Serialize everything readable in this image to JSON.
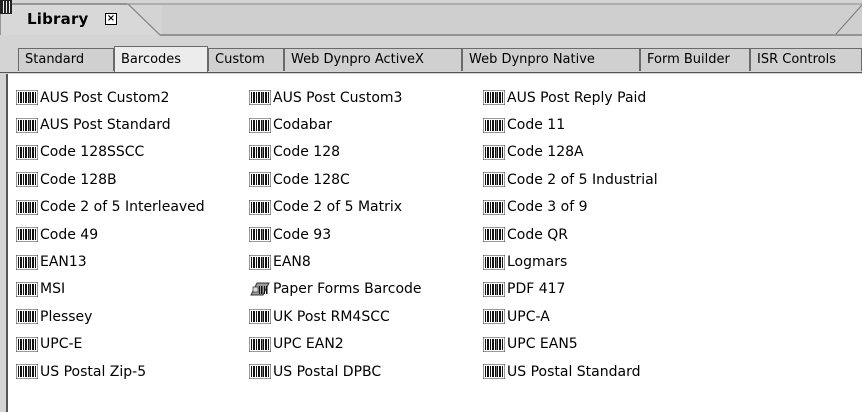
{
  "panel": {
    "title": "Library",
    "close_symbol": "×"
  },
  "tabs": [
    {
      "label": "Standard",
      "active": false
    },
    {
      "label": "Barcodes",
      "active": true
    },
    {
      "label": "Custom",
      "active": false
    },
    {
      "label": "Web Dynpro ActiveX",
      "active": false
    },
    {
      "label": "Web Dynpro Native",
      "active": false
    },
    {
      "label": "Form Builder",
      "active": false
    },
    {
      "label": "ISR Controls",
      "active": false
    }
  ],
  "columns": [
    [
      {
        "label": "AUS Post Custom2",
        "icon": "barcode-icon"
      },
      {
        "label": "AUS Post Standard",
        "icon": "barcode-icon"
      },
      {
        "label": "Code 128SSCC",
        "icon": "barcode-icon"
      },
      {
        "label": "Code 128B",
        "icon": "barcode-icon"
      },
      {
        "label": "Code 2 of 5 Interleaved",
        "icon": "barcode-icon"
      },
      {
        "label": "Code 49",
        "icon": "barcode-icon"
      },
      {
        "label": "EAN13",
        "icon": "barcode-icon"
      },
      {
        "label": "MSI",
        "icon": "barcode-icon"
      },
      {
        "label": "Plessey",
        "icon": "barcode-icon"
      },
      {
        "label": "UPC-E",
        "icon": "barcode-icon"
      },
      {
        "label": "US Postal Zip-5",
        "icon": "barcode-icon"
      }
    ],
    [
      {
        "label": "AUS Post Custom3",
        "icon": "barcode-icon"
      },
      {
        "label": "Codabar",
        "icon": "barcode-icon"
      },
      {
        "label": "Code 128",
        "icon": "barcode-icon"
      },
      {
        "label": "Code 128C",
        "icon": "barcode-icon"
      },
      {
        "label": "Code 2 of 5 Matrix",
        "icon": "barcode-icon"
      },
      {
        "label": "Code 93",
        "icon": "barcode-icon"
      },
      {
        "label": "EAN8",
        "icon": "barcode-icon"
      },
      {
        "label": "Paper Forms Barcode",
        "icon": "paper-forms-barcode-icon"
      },
      {
        "label": "UK Post RM4SCC",
        "icon": "barcode-icon"
      },
      {
        "label": "UPC EAN2",
        "icon": "barcode-icon"
      },
      {
        "label": "US Postal DPBC",
        "icon": "barcode-icon"
      }
    ],
    [
      {
        "label": "AUS Post Reply Paid",
        "icon": "barcode-icon"
      },
      {
        "label": "Code 11",
        "icon": "barcode-icon"
      },
      {
        "label": "Code 128A",
        "icon": "barcode-icon"
      },
      {
        "label": "Code 2 of 5 Industrial",
        "icon": "barcode-icon"
      },
      {
        "label": "Code 3 of 9",
        "icon": "barcode-icon"
      },
      {
        "label": "Code QR",
        "icon": "barcode-icon"
      },
      {
        "label": "Logmars",
        "icon": "barcode-icon"
      },
      {
        "label": "PDF 417",
        "icon": "barcode-icon"
      },
      {
        "label": "UPC-A",
        "icon": "barcode-icon"
      },
      {
        "label": "UPC EAN5",
        "icon": "barcode-icon"
      },
      {
        "label": "US Postal Standard",
        "icon": "barcode-icon"
      }
    ]
  ]
}
